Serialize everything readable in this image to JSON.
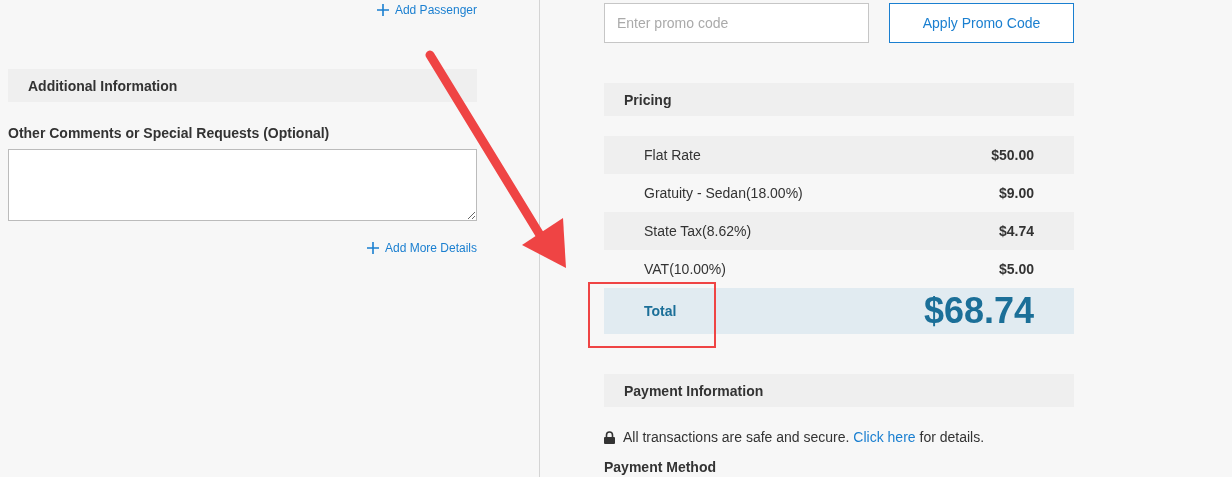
{
  "passengers": {
    "add_link": "Add Passenger"
  },
  "additional_info": {
    "title": "Additional Information",
    "comments_label": "Other Comments or Special Requests (Optional)",
    "add_link": "Add More Details"
  },
  "promo": {
    "placeholder": "Enter promo code",
    "button": "Apply Promo Code"
  },
  "pricing": {
    "title": "Pricing",
    "rows": [
      {
        "label": "Flat Rate",
        "amount": "$50.00"
      },
      {
        "label": "Gratuity - Sedan(18.00%)",
        "amount": "$9.00"
      },
      {
        "label": "State Tax(8.62%)",
        "amount": "$4.74"
      },
      {
        "label": "VAT(10.00%)",
        "amount": "$5.00"
      }
    ],
    "total": {
      "label": "Total",
      "amount": "$68.74"
    }
  },
  "payment": {
    "title": "Payment Information",
    "secure_note": {
      "before": "All transactions are safe and secure.",
      "link": "Click here",
      "after": "for details."
    },
    "method_label": "Payment Method"
  }
}
